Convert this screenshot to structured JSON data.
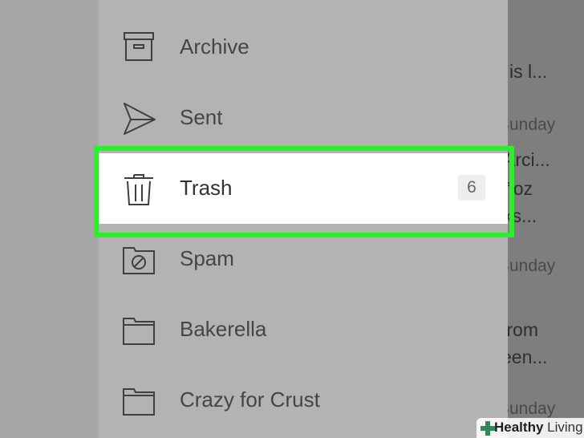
{
  "background_mail": {
    "line1": "is l...",
    "date1": "Sunday",
    "line2": "Arci...",
    "line3": "ñoz",
    "line4": "ks...",
    "date2": "Sunday",
    "line5": "from",
    "line6": "een...",
    "date3": "Sunday"
  },
  "folders": [
    {
      "label": "Archive",
      "icon": "archive-icon"
    },
    {
      "label": "Sent",
      "icon": "send-icon"
    },
    {
      "label": "Trash",
      "icon": "trash-icon",
      "badge": "6",
      "selected": true
    },
    {
      "label": "Spam",
      "icon": "spam-folder-icon"
    },
    {
      "label": "Bakerella",
      "icon": "folder-icon"
    },
    {
      "label": "Crazy for Crust",
      "icon": "folder-icon"
    }
  ],
  "highlight_color": "#2bef2b",
  "watermark": {
    "bold": "Healthy",
    "light": " Living"
  }
}
